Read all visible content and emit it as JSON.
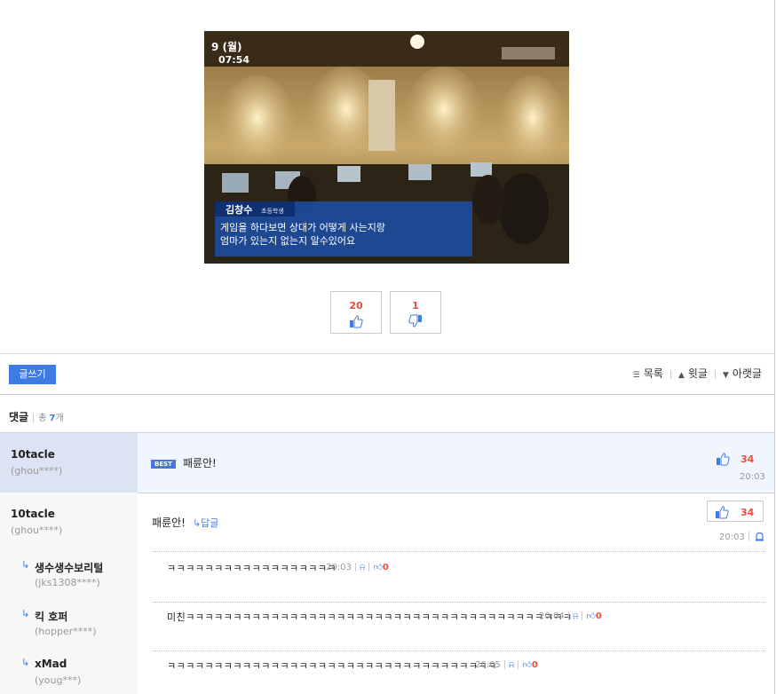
{
  "image": {
    "date_line": "9 (월)",
    "time_line": "07:54",
    "caption_name": "김창수",
    "caption_role": "초등학생",
    "caption_line1": "게임을 하다보면 상대가 어떻게 사는지랑",
    "caption_line2": "엄마가 있는지 없는지 알수있어요"
  },
  "vote": {
    "up_count": "20",
    "down_count": "1",
    "up_icon": "thumbs-up-icon",
    "down_icon": "thumbs-down-icon"
  },
  "toolbar": {
    "write_label": "글쓰기",
    "list_label": "목록",
    "prev_label": "윗글",
    "next_label": "아랫글"
  },
  "comments_header": {
    "title": "댓글",
    "total_prefix": "총",
    "total_count": "7",
    "total_suffix": "개"
  },
  "best_comment": {
    "nick": "10tacle",
    "uid": "(ghou****)",
    "badge": "BEST",
    "text": "패륜안!",
    "likes": "34",
    "time": "20:03"
  },
  "comment": {
    "nick": "10tacle",
    "uid": "(ghou****)",
    "text": "패륜안!",
    "reply_label": "↳답글",
    "likes": "34",
    "time": "20:03"
  },
  "replies": [
    {
      "nick": "생수생수보리털",
      "uid": "(jks1308****)",
      "text": "ㅋㅋㅋㅋㅋㅋㅋㅋㅋㅋㅋㅋㅋㅋㅋㅋㅋㅋ",
      "time": "20:03",
      "likes": "0"
    },
    {
      "nick": "킥 호퍼",
      "uid": "(hopper****)",
      "text": "미친ㅋㅋㅋㅋㅋㅋㅋㅋㅋㅋㅋㅋㅋㅋㅋㅋㅋㅋㅋㅋㅋㅋㅋㅋㅋㅋㅋㅋㅋㅋㅋㅋㅋㅋㅋㅋㅋㅋㅋㅋㅋ",
      "time": "20:04",
      "likes": "0"
    },
    {
      "nick": "xMad",
      "uid": "(youg***)",
      "text": "ㅋㅋㅋㅋㅋㅋㅋㅋㅋㅋㅋㅋㅋㅋㅋㅋㅋㅋㅋㅋㅋㅋㅋㅋㅋㅋㅋㅋㅋㅋㅋㅋㅋㅋㅋ",
      "time": "20:05",
      "likes": "0"
    }
  ],
  "colors": {
    "accent": "#3f7be5",
    "like_count": "#e74c3c",
    "best_bg": "#f1f5fd"
  }
}
